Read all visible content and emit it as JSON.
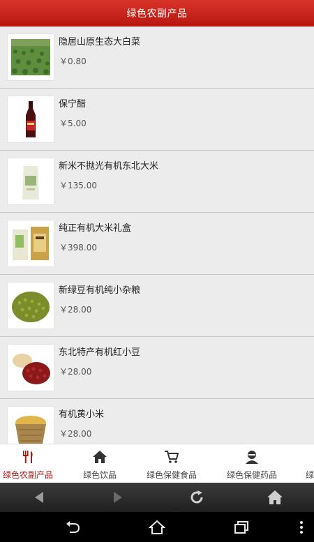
{
  "header": {
    "title": "绿色农副产品"
  },
  "products": [
    {
      "name": "隐居山原生态大白菜",
      "price": "￥0.80"
    },
    {
      "name": "保宁醋",
      "price": "￥5.00"
    },
    {
      "name": "新米不抛光有机东北大米",
      "price": "￥135.00"
    },
    {
      "name": "纯正有机大米礼盒",
      "price": "￥398.00"
    },
    {
      "name": "新绿豆有机纯小杂粮",
      "price": "￥28.00"
    },
    {
      "name": "东北特产有机红小豆",
      "price": "￥28.00"
    },
    {
      "name": "有机黄小米",
      "price": "￥28.00"
    }
  ],
  "tabs": [
    {
      "label": "绿色农副产品",
      "icon": "fork-knife-icon",
      "active": true
    },
    {
      "label": "绿色饮品",
      "icon": "home-icon"
    },
    {
      "label": "绿色保健食品",
      "icon": "cart-icon"
    },
    {
      "label": "绿色保健药品",
      "icon": "person-icon"
    },
    {
      "label": "绿"
    }
  ],
  "browser_bar": {
    "icons": [
      "back-arrow-icon",
      "forward-arrow-icon",
      "refresh-icon",
      "home-icon"
    ]
  },
  "system_nav": {
    "icons": [
      "back-icon",
      "home-outline-icon",
      "recent-apps-icon",
      "overflow-menu-icon"
    ]
  },
  "colors": {
    "accent": "#c0201a",
    "tab_active": "#b2150e"
  }
}
